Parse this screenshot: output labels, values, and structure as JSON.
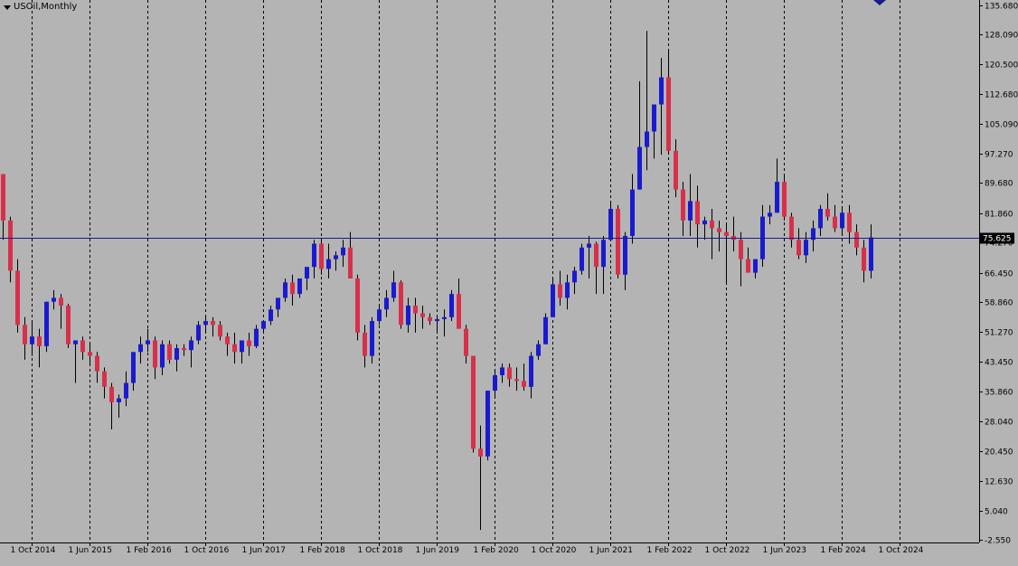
{
  "chart_data": {
    "type": "candlestick",
    "title": "USOil,Monthly",
    "colors": {
      "background": "#b4b4b4",
      "bull": "#1a1ad0",
      "bear": "#d8304a",
      "wick": "#000000",
      "grid": "#000000",
      "price_line": "#1a1a8a"
    },
    "y_ticks": [
      "135.680",
      "128.090",
      "120.500",
      "112.680",
      "105.090",
      "97.270",
      "89.680",
      "81.860",
      "74.270",
      "66.450",
      "58.860",
      "51.270",
      "43.450",
      "35.860",
      "28.040",
      "20.450",
      "12.630",
      "5.040",
      "-2.550"
    ],
    "y_tick_values": [
      135.68,
      128.09,
      120.5,
      112.68,
      105.09,
      97.27,
      89.68,
      81.86,
      74.27,
      66.45,
      58.86,
      51.27,
      43.45,
      35.86,
      28.04,
      20.45,
      12.63,
      5.04,
      -2.55
    ],
    "ylim": [
      -2.55,
      136.3
    ],
    "x_ticks": [
      "1 Oct 2014",
      "1 Jun 2015",
      "1 Feb 2016",
      "1 Oct 2016",
      "1 Jun 2017",
      "1 Feb 2018",
      "1 Oct 2018",
      "1 Jun 2019",
      "1 Feb 2020",
      "1 Oct 2020",
      "1 Jun 2021",
      "1 Feb 2022",
      "1 Oct 2022",
      "1 Jun 2023",
      "1 Feb 2024",
      "1 Oct 2024"
    ],
    "x_tick_index": [
      4,
      12,
      20,
      28,
      36,
      44,
      52,
      60,
      68,
      76,
      84,
      92,
      100,
      108,
      116,
      124
    ],
    "current_price": "75.625",
    "current_price_value": 75.625,
    "candles": [
      [
        92.0,
        92.0,
        75.0,
        80.0
      ],
      [
        80.0,
        81.0,
        64.0,
        67.0
      ],
      [
        67.0,
        70.0,
        51.0,
        53.0
      ],
      [
        53.0,
        55.0,
        44.0,
        48.0
      ],
      [
        48.0,
        54.0,
        45.0,
        50.0
      ],
      [
        50.0,
        52.0,
        42.0,
        47.5
      ],
      [
        47.5,
        59.0,
        46.0,
        59.0
      ],
      [
        59.0,
        62.0,
        57.0,
        60.0
      ],
      [
        60.0,
        61.0,
        52.0,
        58.0
      ],
      [
        58.0,
        58.5,
        47.0,
        48.0
      ],
      [
        48.0,
        48.5,
        38.0,
        49.0
      ],
      [
        49.0,
        50.0,
        44.0,
        46.0
      ],
      [
        46.0,
        48.0,
        43.0,
        45.0
      ],
      [
        45.0,
        46.0,
        38.0,
        41.0
      ],
      [
        41.0,
        42.0,
        34.0,
        37.0
      ],
      [
        37.0,
        38.0,
        26.0,
        33.0
      ],
      [
        33.0,
        35.0,
        29.0,
        34.0
      ],
      [
        34.0,
        41.0,
        32.0,
        38.0
      ],
      [
        38.0,
        46.0,
        36.0,
        46.0
      ],
      [
        46.0,
        50.0,
        43.0,
        48.0
      ],
      [
        48.0,
        52.0,
        46.0,
        49.0
      ],
      [
        49.0,
        50.0,
        39.0,
        42.0
      ],
      [
        42.0,
        49.0,
        40.0,
        48.0
      ],
      [
        48.0,
        49.0,
        43.0,
        44.0
      ],
      [
        44.0,
        48.0,
        41.0,
        47.0
      ],
      [
        47.0,
        48.0,
        45.0,
        46.5
      ],
      [
        46.5,
        50.0,
        42.0,
        49.0
      ],
      [
        49.0,
        54.0,
        48.0,
        53.0
      ],
      [
        53.0,
        55.0,
        51.0,
        54.0
      ],
      [
        54.0,
        55.0,
        50.0,
        53.0
      ],
      [
        53.0,
        54.0,
        49.0,
        50.0
      ],
      [
        50.0,
        51.0,
        45.0,
        48.0
      ],
      [
        48.0,
        51.0,
        43.0,
        46.0
      ],
      [
        46.0,
        49.0,
        43.0,
        49.0
      ],
      [
        49.0,
        51.0,
        45.0,
        47.5
      ],
      [
        47.5,
        53.0,
        47.0,
        52.0
      ],
      [
        52.0,
        54.0,
        51.0,
        54.0
      ],
      [
        54.0,
        58.0,
        53.0,
        57.0
      ],
      [
        57.0,
        60.0,
        55.0,
        60.0
      ],
      [
        60.0,
        65.0,
        59.0,
        64.0
      ],
      [
        64.0,
        66.0,
        58.0,
        61.0
      ],
      [
        61.0,
        65.0,
        60.0,
        65.0
      ],
      [
        65.0,
        67.0,
        62.0,
        68.0
      ],
      [
        68.0,
        75.0,
        65.0,
        74.0
      ],
      [
        74.0,
        75.0,
        66.0,
        67.5
      ],
      [
        67.5,
        74.0,
        65.0,
        70.0
      ],
      [
        70.0,
        72.0,
        67.0,
        71.0
      ],
      [
        71.0,
        75.0,
        68.0,
        73.0
      ],
      [
        73.0,
        77.0,
        65.0,
        65.0
      ],
      [
        65.0,
        66.0,
        49.0,
        51.0
      ],
      [
        51.0,
        53.0,
        42.0,
        45.0
      ],
      [
        45.0,
        55.0,
        43.0,
        54.0
      ],
      [
        54.0,
        58.0,
        53.0,
        57.0
      ],
      [
        57.0,
        62.0,
        55.0,
        60.0
      ],
      [
        60.0,
        67.0,
        59.0,
        64.0
      ],
      [
        64.0,
        64.5,
        52.0,
        53.0
      ],
      [
        53.0,
        60.0,
        51.0,
        58.0
      ],
      [
        58.0,
        60.0,
        51.0,
        56.0
      ],
      [
        56.0,
        58.0,
        52.0,
        55.0
      ],
      [
        55.0,
        56.0,
        53.0,
        54.0
      ],
      [
        54.0,
        55.0,
        51.0,
        54.5
      ],
      [
        54.5,
        57.0,
        50.0,
        55.0
      ],
      [
        55.0,
        62.0,
        54.0,
        61.0
      ],
      [
        61.0,
        65.0,
        55.0,
        52.0
      ],
      [
        52.0,
        53.0,
        43.0,
        45.0
      ],
      [
        45.0,
        45.0,
        20.0,
        21.0
      ],
      [
        21.0,
        27.0,
        0.0,
        19.0
      ],
      [
        19.0,
        36.0,
        18.0,
        36.0
      ],
      [
        36.0,
        41.0,
        34.0,
        40.0
      ],
      [
        40.0,
        43.0,
        38.0,
        42.0
      ],
      [
        42.0,
        43.0,
        37.0,
        39.0
      ],
      [
        39.0,
        42.0,
        36.0,
        38.5
      ],
      [
        38.5,
        43.0,
        36.0,
        37.0
      ],
      [
        37.0,
        46.0,
        34.0,
        45.0
      ],
      [
        45.0,
        49.0,
        44.0,
        48.0
      ],
      [
        48.0,
        56.0,
        48.0,
        55.0
      ],
      [
        55.0,
        65.0,
        55.0,
        63.5
      ],
      [
        63.5,
        67.0,
        58.0,
        60.0
      ],
      [
        60.0,
        66.0,
        57.0,
        64.0
      ],
      [
        64.0,
        68.0,
        61.0,
        67.0
      ],
      [
        67.0,
        74.0,
        66.0,
        73.0
      ],
      [
        73.0,
        76.0,
        65.0,
        74.0
      ],
      [
        74.0,
        74.5,
        61.0,
        68.0
      ],
      [
        68.0,
        76.0,
        61.0,
        75.0
      ],
      [
        75.0,
        85.0,
        75.0,
        83.0
      ],
      [
        83.0,
        84.0,
        65.0,
        66.0
      ],
      [
        66.0,
        77.0,
        62.0,
        76.0
      ],
      [
        76.0,
        92.0,
        74.0,
        88.0
      ],
      [
        88.0,
        116.0,
        88.0,
        99.0
      ],
      [
        99.0,
        129.0,
        93.0,
        103.0
      ],
      [
        103.0,
        109.0,
        96.0,
        110.0
      ],
      [
        110.0,
        122.0,
        97.0,
        117.0
      ],
      [
        117.0,
        124.0,
        97.0,
        98.0
      ],
      [
        98.0,
        101.0,
        86.0,
        88.0
      ],
      [
        88.0,
        90.0,
        76.0,
        80.0
      ],
      [
        80.0,
        92.0,
        76.0,
        85.0
      ],
      [
        85.0,
        89.0,
        73.0,
        79.0
      ],
      [
        79.0,
        81.0,
        75.0,
        80.0
      ],
      [
        80.0,
        83.0,
        70.0,
        78.0
      ],
      [
        78.0,
        80.0,
        72.0,
        77.0
      ],
      [
        77.0,
        79.0,
        64.0,
        76.0
      ],
      [
        76.0,
        81.0,
        72.0,
        75.0
      ],
      [
        75.0,
        77.0,
        63.0,
        70.0
      ],
      [
        70.0,
        73.0,
        68.0,
        66.5
      ],
      [
        66.5,
        70.0,
        65.0,
        70.0
      ],
      [
        70.0,
        84.0,
        68.0,
        81.0
      ],
      [
        81.0,
        84.0,
        79.0,
        82.0
      ],
      [
        82.0,
        96.0,
        82.0,
        90.0
      ],
      [
        90.0,
        92.0,
        80.0,
        81.0
      ],
      [
        81.0,
        82.0,
        73.0,
        75.0
      ],
      [
        75.0,
        78.0,
        70.0,
        71.0
      ],
      [
        71.0,
        77.0,
        69.0,
        75.0
      ],
      [
        75.0,
        80.0,
        72.0,
        78.0
      ],
      [
        78.0,
        84.0,
        76.0,
        83.0
      ],
      [
        83.0,
        87.0,
        80.0,
        81.0
      ],
      [
        81.0,
        84.0,
        77.0,
        78.0
      ],
      [
        78.0,
        83.0,
        76.0,
        82.0
      ],
      [
        82.0,
        84.0,
        74.0,
        77.0
      ],
      [
        77.0,
        79.0,
        71.0,
        73.0
      ],
      [
        73.0,
        75.0,
        64.0,
        67.0
      ],
      [
        67.0,
        79.0,
        65.0,
        75.625
      ]
    ]
  }
}
